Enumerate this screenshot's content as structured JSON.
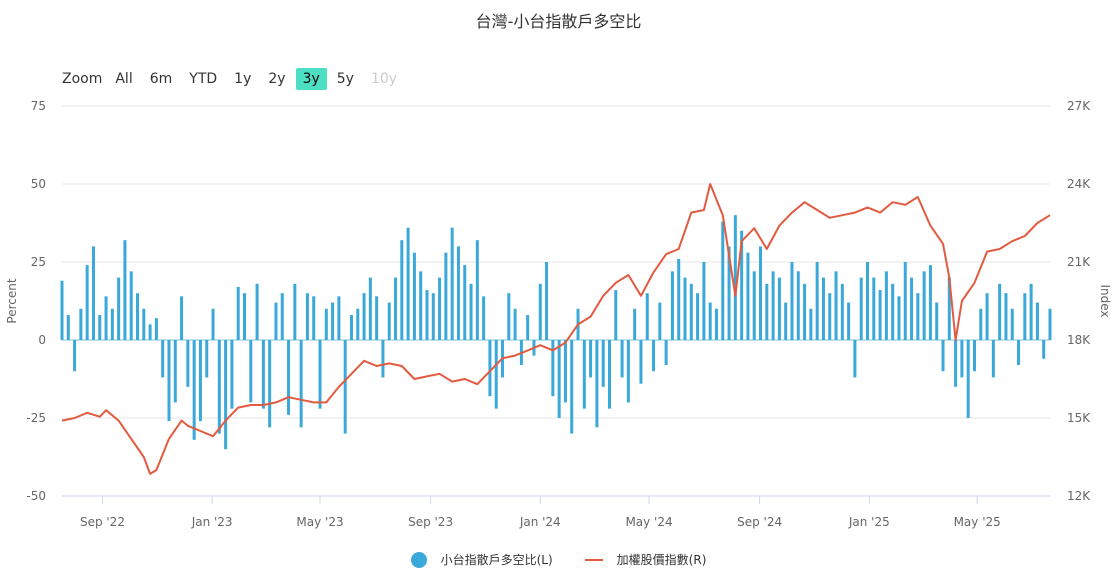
{
  "title": "台灣-小台指散戶多空比",
  "range_selector": {
    "zoom_label": "Zoom",
    "buttons": [
      {
        "label": "All",
        "state": "normal"
      },
      {
        "label": "6m",
        "state": "normal"
      },
      {
        "label": "YTD",
        "state": "normal"
      },
      {
        "label": "1y",
        "state": "normal"
      },
      {
        "label": "2y",
        "state": "normal"
      },
      {
        "label": "3y",
        "state": "active"
      },
      {
        "label": "5y",
        "state": "normal"
      },
      {
        "label": "10y",
        "state": "disabled"
      }
    ]
  },
  "legend": {
    "bar_label": "小台指散戶多空比(L)",
    "line_label": "加權股價指數(R)"
  },
  "colors": {
    "bar": "#3aa8d8",
    "line": "#e25a3f",
    "grid": "#e6e6e6",
    "axis_text": "#666666",
    "active_button": "#4ddfc4"
  },
  "chart_data": {
    "type": "bar+line",
    "grid": true,
    "legend_position": "bottom-center",
    "x_range": [
      "2022-07-18",
      "2025-07-21"
    ],
    "x_ticks": [
      {
        "label": "Sep '22",
        "date": "2022-09-01"
      },
      {
        "label": "Jan '23",
        "date": "2023-01-01"
      },
      {
        "label": "May '23",
        "date": "2023-05-01"
      },
      {
        "label": "Sep '23",
        "date": "2023-09-01"
      },
      {
        "label": "Jan '24",
        "date": "2024-01-01"
      },
      {
        "label": "May '24",
        "date": "2024-05-01"
      },
      {
        "label": "Sep '24",
        "date": "2024-09-01"
      },
      {
        "label": "Jan '25",
        "date": "2025-01-01"
      },
      {
        "label": "May '25",
        "date": "2025-05-01"
      }
    ],
    "y_left": {
      "label": "Percent",
      "min": -50,
      "max": 75,
      "ticks": [
        "-50",
        "-25",
        "0",
        "25",
        "50",
        "75"
      ]
    },
    "y_right": {
      "label": "Index",
      "min": 12000,
      "max": 27000,
      "ticks": [
        "12K",
        "15K",
        "18K",
        "21K",
        "24K",
        "27K"
      ]
    },
    "series": [
      {
        "name": "小台指散戶多空比(L)",
        "type": "bar",
        "axis": "left",
        "points": [
          [
            "2022-07-18",
            19
          ],
          [
            "2022-07-25",
            8
          ],
          [
            "2022-08-01",
            -10
          ],
          [
            "2022-08-08",
            10
          ],
          [
            "2022-08-15",
            24
          ],
          [
            "2022-08-22",
            30
          ],
          [
            "2022-08-29",
            8
          ],
          [
            "2022-09-05",
            14
          ],
          [
            "2022-09-12",
            10
          ],
          [
            "2022-09-19",
            20
          ],
          [
            "2022-09-26",
            32
          ],
          [
            "2022-10-03",
            22
          ],
          [
            "2022-10-10",
            15
          ],
          [
            "2022-10-17",
            10
          ],
          [
            "2022-10-24",
            5
          ],
          [
            "2022-10-31",
            7
          ],
          [
            "2022-11-07",
            -12
          ],
          [
            "2022-11-14",
            -26
          ],
          [
            "2022-11-21",
            -20
          ],
          [
            "2022-11-28",
            14
          ],
          [
            "2022-12-05",
            -15
          ],
          [
            "2022-12-12",
            -32
          ],
          [
            "2022-12-19",
            -26
          ],
          [
            "2022-12-26",
            -12
          ],
          [
            "2023-01-02",
            10
          ],
          [
            "2023-01-09",
            -30
          ],
          [
            "2023-01-16",
            -35
          ],
          [
            "2023-01-23",
            -22
          ],
          [
            "2023-01-30",
            17
          ],
          [
            "2023-02-06",
            15
          ],
          [
            "2023-02-13",
            -20
          ],
          [
            "2023-02-20",
            18
          ],
          [
            "2023-02-27",
            -22
          ],
          [
            "2023-03-06",
            -28
          ],
          [
            "2023-03-13",
            12
          ],
          [
            "2023-03-20",
            15
          ],
          [
            "2023-03-27",
            -24
          ],
          [
            "2023-04-03",
            18
          ],
          [
            "2023-04-10",
            -28
          ],
          [
            "2023-04-17",
            15
          ],
          [
            "2023-04-24",
            14
          ],
          [
            "2023-05-01",
            -22
          ],
          [
            "2023-05-08",
            10
          ],
          [
            "2023-05-15",
            12
          ],
          [
            "2023-05-22",
            14
          ],
          [
            "2023-05-29",
            -30
          ],
          [
            "2023-06-05",
            8
          ],
          [
            "2023-06-12",
            10
          ],
          [
            "2023-06-19",
            15
          ],
          [
            "2023-06-26",
            20
          ],
          [
            "2023-07-03",
            14
          ],
          [
            "2023-07-10",
            -12
          ],
          [
            "2023-07-17",
            12
          ],
          [
            "2023-07-24",
            20
          ],
          [
            "2023-07-31",
            32
          ],
          [
            "2023-08-07",
            36
          ],
          [
            "2023-08-14",
            28
          ],
          [
            "2023-08-21",
            22
          ],
          [
            "2023-08-28",
            16
          ],
          [
            "2023-09-04",
            15
          ],
          [
            "2023-09-11",
            20
          ],
          [
            "2023-09-18",
            28
          ],
          [
            "2023-09-25",
            36
          ],
          [
            "2023-10-02",
            30
          ],
          [
            "2023-10-09",
            24
          ],
          [
            "2023-10-16",
            18
          ],
          [
            "2023-10-23",
            32
          ],
          [
            "2023-10-30",
            14
          ],
          [
            "2023-11-06",
            -18
          ],
          [
            "2023-11-13",
            -22
          ],
          [
            "2023-11-20",
            -12
          ],
          [
            "2023-11-27",
            15
          ],
          [
            "2023-12-04",
            10
          ],
          [
            "2023-12-11",
            -8
          ],
          [
            "2023-12-18",
            8
          ],
          [
            "2023-12-25",
            -5
          ],
          [
            "2024-01-01",
            18
          ],
          [
            "2024-01-08",
            25
          ],
          [
            "2024-01-15",
            -18
          ],
          [
            "2024-01-22",
            -25
          ],
          [
            "2024-01-29",
            -20
          ],
          [
            "2024-02-05",
            -30
          ],
          [
            "2024-02-12",
            10
          ],
          [
            "2024-02-19",
            -22
          ],
          [
            "2024-02-26",
            -12
          ],
          [
            "2024-03-04",
            -28
          ],
          [
            "2024-03-11",
            -15
          ],
          [
            "2024-03-18",
            -22
          ],
          [
            "2024-03-25",
            16
          ],
          [
            "2024-04-01",
            -12
          ],
          [
            "2024-04-08",
            -20
          ],
          [
            "2024-04-15",
            10
          ],
          [
            "2024-04-22",
            -14
          ],
          [
            "2024-04-29",
            15
          ],
          [
            "2024-05-06",
            -10
          ],
          [
            "2024-05-13",
            12
          ],
          [
            "2024-05-20",
            -8
          ],
          [
            "2024-05-27",
            22
          ],
          [
            "2024-06-03",
            26
          ],
          [
            "2024-06-10",
            20
          ],
          [
            "2024-06-17",
            18
          ],
          [
            "2024-06-24",
            15
          ],
          [
            "2024-07-01",
            25
          ],
          [
            "2024-07-08",
            12
          ],
          [
            "2024-07-15",
            10
          ],
          [
            "2024-07-22",
            38
          ],
          [
            "2024-07-29",
            30
          ],
          [
            "2024-08-05",
            40
          ],
          [
            "2024-08-12",
            35
          ],
          [
            "2024-08-19",
            28
          ],
          [
            "2024-08-26",
            22
          ],
          [
            "2024-09-02",
            30
          ],
          [
            "2024-09-09",
            18
          ],
          [
            "2024-09-16",
            22
          ],
          [
            "2024-09-23",
            20
          ],
          [
            "2024-09-30",
            12
          ],
          [
            "2024-10-07",
            25
          ],
          [
            "2024-10-14",
            22
          ],
          [
            "2024-10-21",
            18
          ],
          [
            "2024-10-28",
            10
          ],
          [
            "2024-11-04",
            25
          ],
          [
            "2024-11-11",
            20
          ],
          [
            "2024-11-18",
            15
          ],
          [
            "2024-11-25",
            22
          ],
          [
            "2024-12-02",
            18
          ],
          [
            "2024-12-09",
            12
          ],
          [
            "2024-12-16",
            -12
          ],
          [
            "2024-12-23",
            20
          ],
          [
            "2024-12-30",
            25
          ],
          [
            "2025-01-06",
            20
          ],
          [
            "2025-01-13",
            16
          ],
          [
            "2025-01-20",
            22
          ],
          [
            "2025-01-27",
            18
          ],
          [
            "2025-02-03",
            14
          ],
          [
            "2025-02-10",
            25
          ],
          [
            "2025-02-17",
            20
          ],
          [
            "2025-02-24",
            15
          ],
          [
            "2025-03-03",
            22
          ],
          [
            "2025-03-10",
            24
          ],
          [
            "2025-03-17",
            12
          ],
          [
            "2025-03-24",
            -10
          ],
          [
            "2025-03-31",
            20
          ],
          [
            "2025-04-07",
            -15
          ],
          [
            "2025-04-14",
            -12
          ],
          [
            "2025-04-21",
            -25
          ],
          [
            "2025-04-28",
            -10
          ],
          [
            "2025-05-05",
            10
          ],
          [
            "2025-05-12",
            15
          ],
          [
            "2025-05-19",
            -12
          ],
          [
            "2025-05-26",
            18
          ],
          [
            "2025-06-02",
            15
          ],
          [
            "2025-06-09",
            10
          ],
          [
            "2025-06-16",
            -8
          ],
          [
            "2025-06-23",
            15
          ],
          [
            "2025-06-30",
            18
          ],
          [
            "2025-07-07",
            12
          ],
          [
            "2025-07-14",
            -6
          ],
          [
            "2025-07-21",
            10
          ]
        ]
      },
      {
        "name": "加權股價指數(R)",
        "type": "line",
        "axis": "right",
        "points": [
          [
            "2022-07-18",
            14900
          ],
          [
            "2022-08-01",
            15000
          ],
          [
            "2022-08-15",
            15200
          ],
          [
            "2022-08-29",
            15050
          ],
          [
            "2022-09-05",
            15300
          ],
          [
            "2022-09-19",
            14900
          ],
          [
            "2022-10-03",
            14200
          ],
          [
            "2022-10-17",
            13500
          ],
          [
            "2022-10-24",
            12850
          ],
          [
            "2022-10-31",
            13000
          ],
          [
            "2022-11-14",
            14200
          ],
          [
            "2022-11-28",
            14900
          ],
          [
            "2022-12-05",
            14700
          ],
          [
            "2022-12-19",
            14500
          ],
          [
            "2023-01-02",
            14300
          ],
          [
            "2023-01-16",
            14900
          ],
          [
            "2023-01-30",
            15400
          ],
          [
            "2023-02-13",
            15500
          ],
          [
            "2023-02-27",
            15500
          ],
          [
            "2023-03-13",
            15600
          ],
          [
            "2023-03-27",
            15800
          ],
          [
            "2023-04-10",
            15700
          ],
          [
            "2023-04-24",
            15600
          ],
          [
            "2023-05-08",
            15600
          ],
          [
            "2023-05-22",
            16200
          ],
          [
            "2023-06-05",
            16700
          ],
          [
            "2023-06-19",
            17200
          ],
          [
            "2023-07-03",
            17000
          ],
          [
            "2023-07-17",
            17100
          ],
          [
            "2023-07-31",
            17000
          ],
          [
            "2023-08-14",
            16500
          ],
          [
            "2023-08-28",
            16600
          ],
          [
            "2023-09-11",
            16700
          ],
          [
            "2023-09-25",
            16400
          ],
          [
            "2023-10-09",
            16500
          ],
          [
            "2023-10-23",
            16300
          ],
          [
            "2023-11-06",
            16800
          ],
          [
            "2023-11-20",
            17300
          ],
          [
            "2023-12-04",
            17400
          ],
          [
            "2023-12-18",
            17600
          ],
          [
            "2024-01-01",
            17800
          ],
          [
            "2024-01-15",
            17600
          ],
          [
            "2024-01-29",
            17900
          ],
          [
            "2024-02-12",
            18600
          ],
          [
            "2024-02-26",
            18900
          ],
          [
            "2024-03-11",
            19700
          ],
          [
            "2024-03-25",
            20200
          ],
          [
            "2024-04-08",
            20500
          ],
          [
            "2024-04-22",
            19700
          ],
          [
            "2024-05-06",
            20600
          ],
          [
            "2024-05-20",
            21300
          ],
          [
            "2024-06-03",
            21500
          ],
          [
            "2024-06-17",
            22900
          ],
          [
            "2024-07-01",
            23000
          ],
          [
            "2024-07-08",
            24000
          ],
          [
            "2024-07-22",
            22800
          ],
          [
            "2024-08-05",
            19700
          ],
          [
            "2024-08-12",
            21800
          ],
          [
            "2024-08-26",
            22300
          ],
          [
            "2024-09-09",
            21500
          ],
          [
            "2024-09-23",
            22400
          ],
          [
            "2024-10-07",
            22900
          ],
          [
            "2024-10-21",
            23300
          ],
          [
            "2024-11-04",
            23000
          ],
          [
            "2024-11-18",
            22700
          ],
          [
            "2024-12-02",
            22800
          ],
          [
            "2024-12-16",
            22900
          ],
          [
            "2024-12-30",
            23100
          ],
          [
            "2025-01-13",
            22900
          ],
          [
            "2025-01-27",
            23300
          ],
          [
            "2025-02-10",
            23200
          ],
          [
            "2025-02-24",
            23500
          ],
          [
            "2025-03-10",
            22400
          ],
          [
            "2025-03-24",
            21700
          ],
          [
            "2025-03-31",
            20400
          ],
          [
            "2025-04-07",
            18000
          ],
          [
            "2025-04-14",
            19500
          ],
          [
            "2025-04-28",
            20200
          ],
          [
            "2025-05-12",
            21400
          ],
          [
            "2025-05-26",
            21500
          ],
          [
            "2025-06-09",
            21800
          ],
          [
            "2025-06-23",
            22000
          ],
          [
            "2025-07-07",
            22500
          ],
          [
            "2025-07-21",
            22800
          ]
        ]
      }
    ]
  }
}
